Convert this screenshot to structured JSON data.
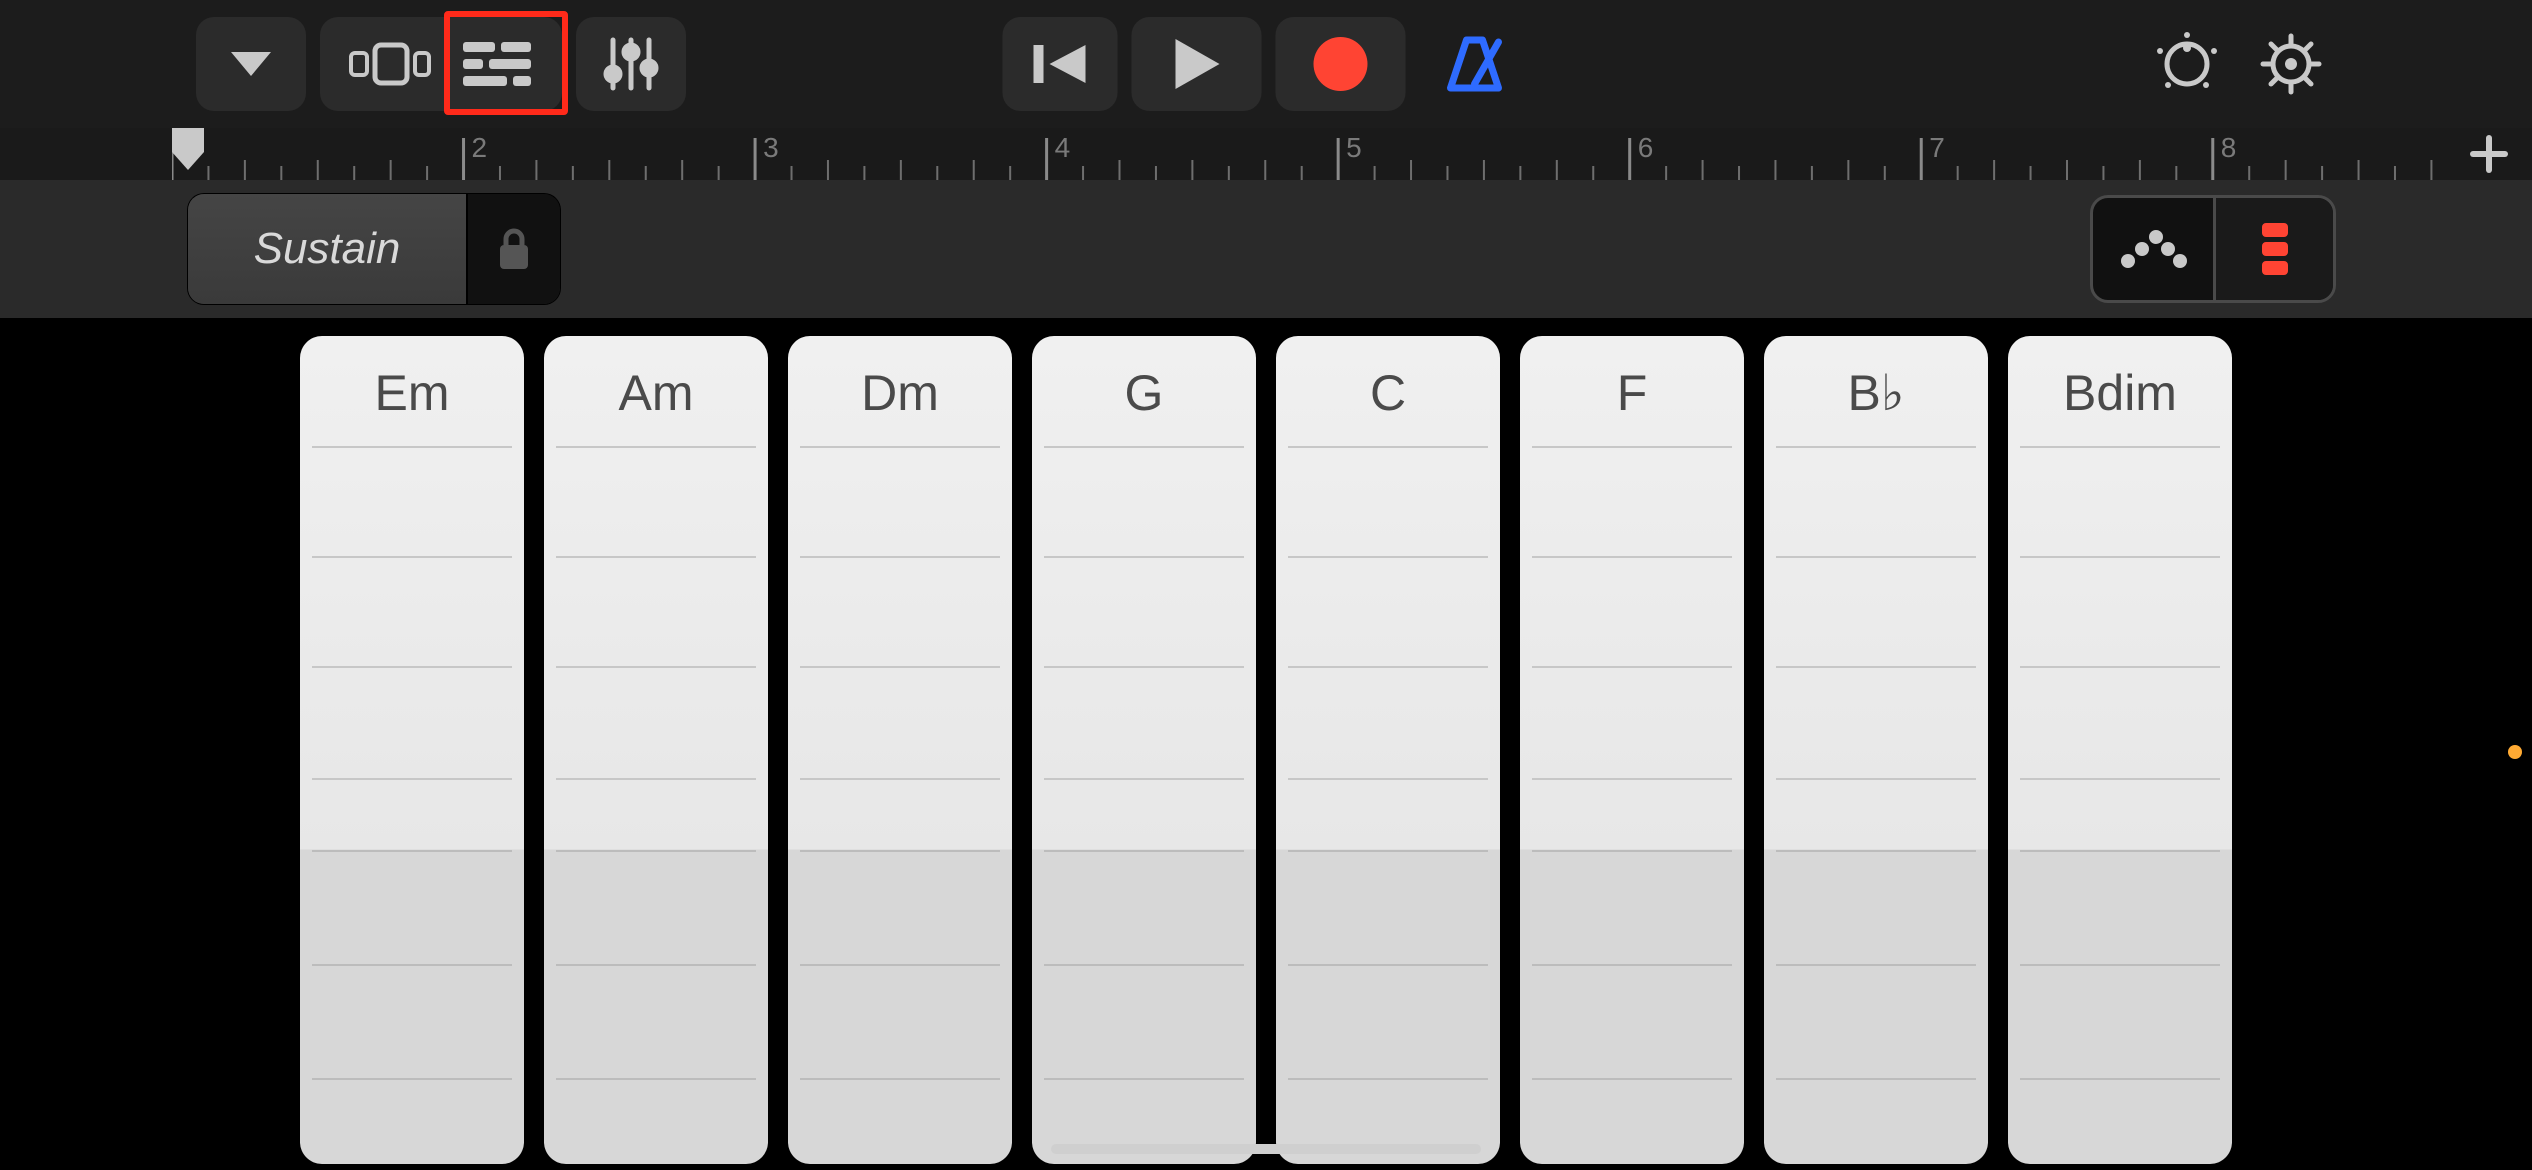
{
  "toolbar": {
    "browser_icon": "triangle-down",
    "tracks_view_icon": "tracks",
    "fx_icon": "sliders",
    "rewind_icon": "skip-back",
    "play_icon": "play",
    "record_icon": "record",
    "metronome_icon": "metronome",
    "tempo_icon": "dial",
    "settings_icon": "gear",
    "highlighted_button": "tracks-view"
  },
  "ruler": {
    "bars": [
      "2",
      "3",
      "4",
      "5",
      "6",
      "7",
      "8"
    ],
    "add_icon": "plus"
  },
  "instrument_strip": {
    "sustain_label": "Sustain",
    "lock_icon": "lock",
    "mode": {
      "autoplay_icon": "autoplay-dots",
      "chordstrips_icon": "chord-strips",
      "active": "chord-strips"
    }
  },
  "chords": [
    {
      "label": "Em"
    },
    {
      "label": "Am"
    },
    {
      "label": "Dm"
    },
    {
      "label": "G"
    },
    {
      "label": "C"
    },
    {
      "label": "F"
    },
    {
      "label": "B♭"
    },
    {
      "label": "Bdim"
    }
  ]
}
